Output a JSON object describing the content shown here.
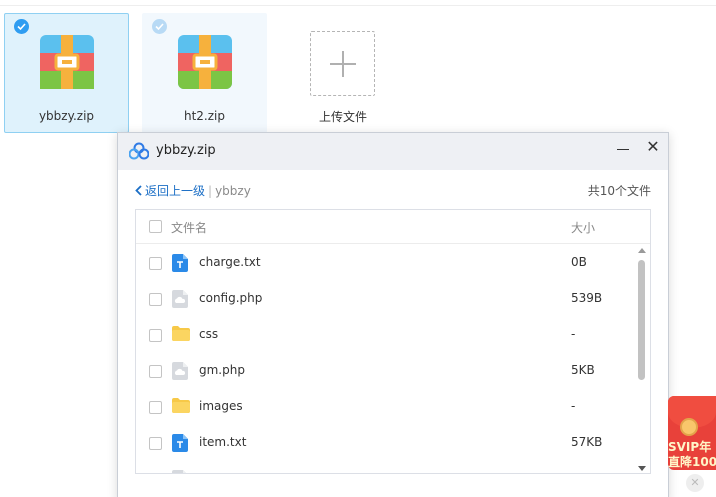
{
  "files": [
    {
      "name": "ybbzy.zip",
      "selected": true,
      "icon": "zip-archive-icon"
    },
    {
      "name": "ht2.zip",
      "selected": false,
      "icon": "zip-archive-icon"
    }
  ],
  "upload": {
    "label": "上传文件",
    "icon": "plus-icon"
  },
  "dialog": {
    "title": "ybbzy.zip",
    "logo": "baidu-netdisk-logo",
    "nav": {
      "back_label": "返回上一级",
      "separator": "|",
      "crumb": "ybbzy"
    },
    "count": "共10个文件",
    "columns": {
      "name": "文件名",
      "size": "大小"
    },
    "rows": [
      {
        "name": "charge.txt",
        "size": "0B",
        "icon": "text-file-icon"
      },
      {
        "name": "config.php",
        "size": "539B",
        "icon": "php-file-icon"
      },
      {
        "name": "css",
        "size": "-",
        "icon": "folder-icon"
      },
      {
        "name": "gm.php",
        "size": "5KB",
        "icon": "php-file-icon"
      },
      {
        "name": "images",
        "size": "-",
        "icon": "folder-icon"
      },
      {
        "name": "item.txt",
        "size": "57KB",
        "icon": "text-file-icon"
      }
    ]
  },
  "promo": {
    "line1": "SVIP年",
    "line2": "直降100"
  },
  "colors": {
    "accent": "#2f9df1",
    "link": "#1c6fc6",
    "folder": "#f7c948",
    "txt_icon": "#2b8ae8",
    "promo_red": "#e8413a"
  }
}
